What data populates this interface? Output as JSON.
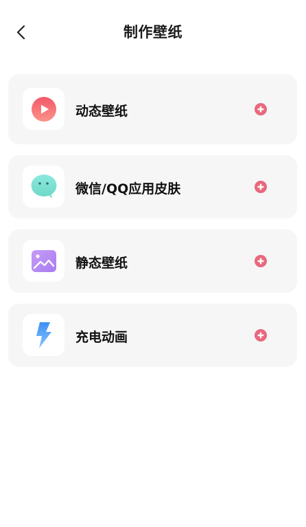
{
  "header": {
    "title": "制作壁纸",
    "back_icon": "chevron-left-icon"
  },
  "items": [
    {
      "label": "动态壁纸",
      "icon": "play-circle-icon",
      "action_icon": "plus-circle-icon"
    },
    {
      "label": "微信/QQ应用皮肤",
      "icon": "chat-bubble-icon",
      "action_icon": "plus-circle-icon"
    },
    {
      "label": "静态壁纸",
      "icon": "image-icon",
      "action_icon": "plus-circle-icon"
    },
    {
      "label": "充电动画",
      "icon": "lightning-icon",
      "action_icon": "plus-circle-icon"
    }
  ],
  "colors": {
    "card_bg": "#f6f6f6",
    "accent_pink": "#e8697d",
    "play_icon": "#f26b72",
    "chat_icon": "#7fe3d4",
    "image_icon": "#b98ff0",
    "lightning_icon": "#4aa8f5"
  }
}
